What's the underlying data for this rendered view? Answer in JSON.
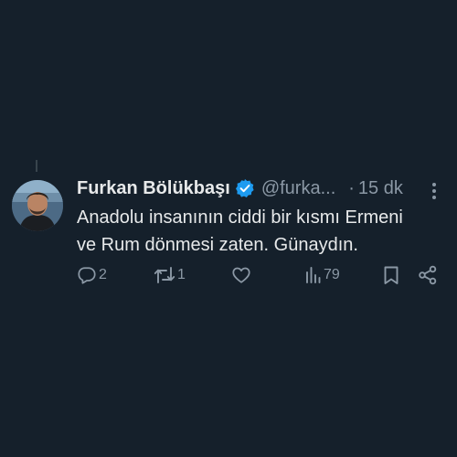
{
  "tweet": {
    "display_name": "Furkan Bölükbaşı",
    "handle": "@furka...",
    "separator": "·",
    "timestamp": "15 dk",
    "text_line1": "Anadolu insanının ciddi bir kısmı Ermeni",
    "text_line2": "ve Rum dönmesi zaten. Günaydın.",
    "verified": true
  },
  "actions": {
    "reply_count": "2",
    "retweet_count": "1",
    "like_count": "",
    "views_count": "79"
  },
  "icons": {
    "verified": "verified-badge-icon",
    "more": "more-options-icon",
    "reply": "reply-icon",
    "retweet": "retweet-icon",
    "like": "heart-icon",
    "views": "views-icon",
    "bookmark": "bookmark-icon",
    "share": "share-icon"
  },
  "colors": {
    "background": "#15202b",
    "text": "#e7e9ea",
    "secondary_text": "#8b98a5",
    "verified_blue": "#1d9bf0"
  }
}
